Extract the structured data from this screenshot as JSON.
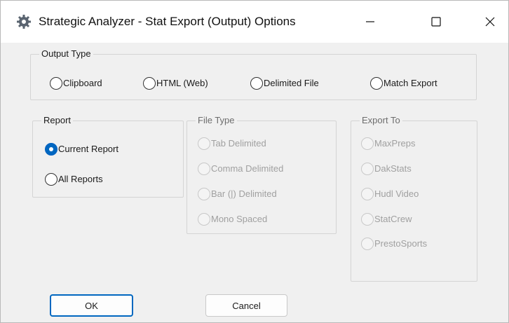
{
  "window": {
    "title": "Strategic Analyzer - Stat Export (Output) Options",
    "app_icon": "gear-icon",
    "controls": [
      "minimize-icon",
      "maximize-icon",
      "close-icon"
    ]
  },
  "output_type": {
    "legend": "Output Type",
    "options": [
      {
        "label": "Clipboard",
        "checked": false,
        "enabled": true
      },
      {
        "label": "HTML (Web)",
        "checked": false,
        "enabled": true
      },
      {
        "label": "Delimited File",
        "checked": false,
        "enabled": true
      },
      {
        "label": "Match Export",
        "checked": false,
        "enabled": true
      }
    ]
  },
  "report": {
    "legend": "Report",
    "options": [
      {
        "label": "Current Report",
        "checked": true,
        "enabled": true
      },
      {
        "label": "All Reports",
        "checked": false,
        "enabled": true
      }
    ]
  },
  "file_type": {
    "legend": "File Type",
    "enabled": false,
    "options": [
      {
        "label": "Tab Delimited",
        "checked": false,
        "enabled": false
      },
      {
        "label": "Comma Delimited",
        "checked": false,
        "enabled": false
      },
      {
        "label": "Bar (|) Delimited",
        "checked": false,
        "enabled": false
      },
      {
        "label": "Mono Spaced",
        "checked": false,
        "enabled": false
      }
    ]
  },
  "export_to": {
    "legend": "Export To",
    "enabled": false,
    "options": [
      {
        "label": "MaxPreps",
        "checked": false,
        "enabled": false
      },
      {
        "label": "DakStats",
        "checked": false,
        "enabled": false
      },
      {
        "label": "Hudl Video",
        "checked": false,
        "enabled": false
      },
      {
        "label": "StatCrew",
        "checked": false,
        "enabled": false
      },
      {
        "label": "PrestoSports",
        "checked": false,
        "enabled": false
      }
    ]
  },
  "buttons": {
    "ok": "OK",
    "cancel": "Cancel"
  },
  "colors": {
    "accent": "#0067c0",
    "dialog_background": "#f0f0f0",
    "disabled_text": "#a0a0a0"
  }
}
